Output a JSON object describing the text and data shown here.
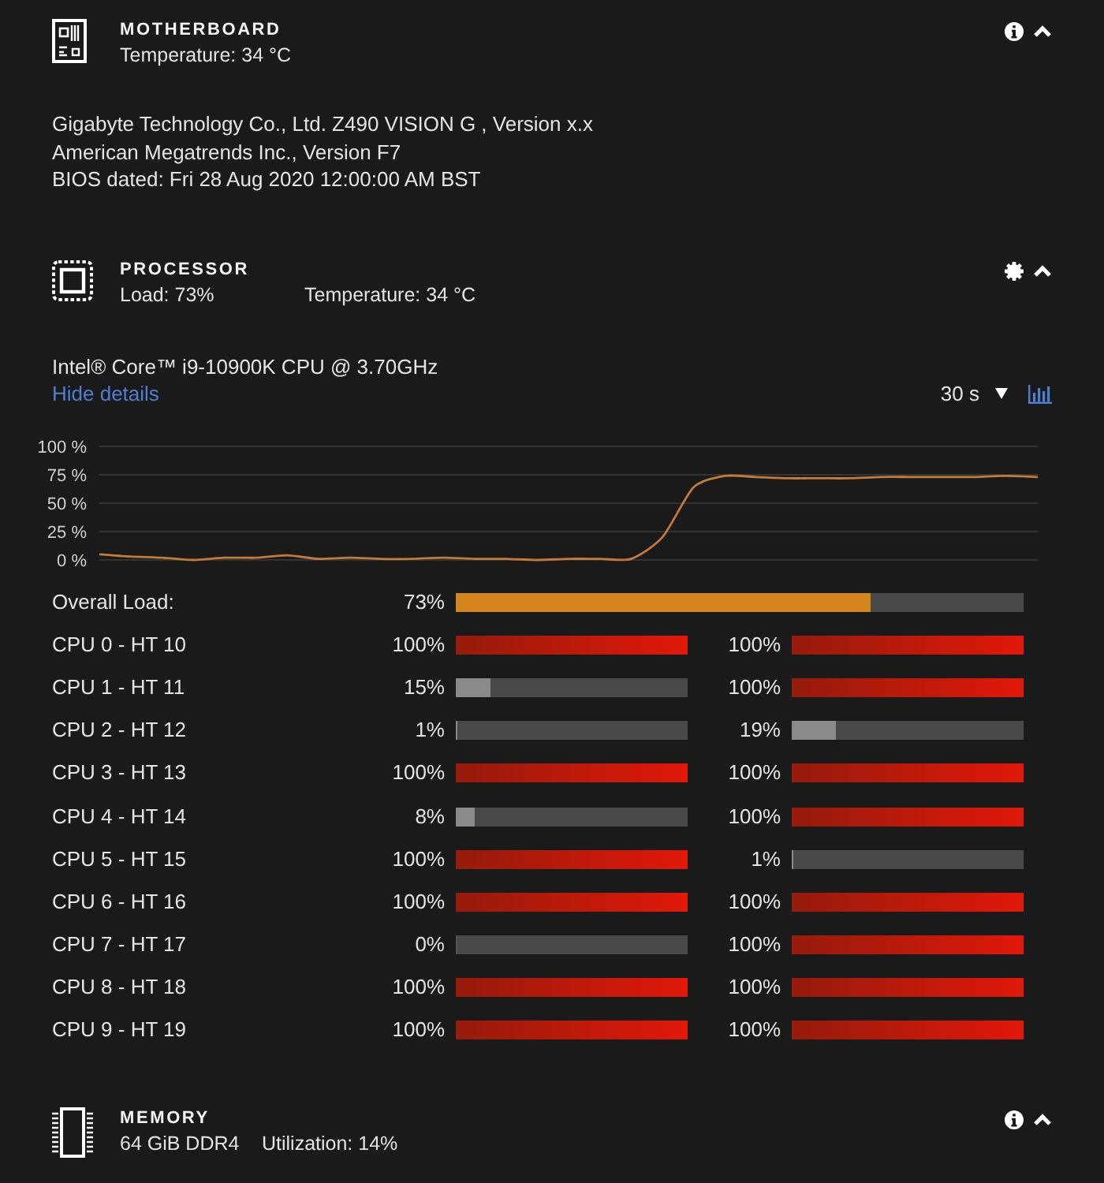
{
  "sections": [
    {
      "kind": "motherboard",
      "title": "MOTHERBOARD",
      "expanded": true,
      "stats": [
        "Temperature: 34 °C"
      ],
      "details": [
        "Gigabyte Technology Co., Ltd. Z490 VISION G , Version x.x",
        "American Megatrends Inc., Version F7",
        "BIOS dated: Fri 28 Aug 2020 12:00:00 AM BST"
      ]
    },
    {
      "kind": "processor",
      "title": "PROCESSOR",
      "expanded": true,
      "stats": [
        "Load: 73%",
        "Temperature: 34 °C"
      ],
      "details": [
        "Intel® Core™ i9-10900K CPU @ 3.70GHz"
      ],
      "toggle_link": "Hide details",
      "interval": "30 s",
      "chart_data": {
        "type": "line",
        "grid": true,
        "ylim": [
          0,
          100
        ],
        "yticks": [
          {
            "value": 0,
            "label": "0 %"
          },
          {
            "value": 25,
            "label": "25 %"
          },
          {
            "value": 50,
            "label": "50 %"
          },
          {
            "value": 75,
            "label": "75 %"
          },
          {
            "value": 100,
            "label": "100 %"
          }
        ],
        "values": [
          5,
          3,
          2,
          0,
          2,
          2,
          4,
          1,
          2,
          1,
          1,
          2,
          1,
          1,
          0,
          1,
          1,
          1,
          20,
          64,
          74,
          73,
          72,
          72,
          72,
          73,
          73,
          73,
          73,
          74,
          73
        ]
      },
      "overall": {
        "label": "Overall Load:",
        "reading": "73%",
        "level": 0.73
      },
      "cores": [
        {
          "label": "CPU 0 - HT 10",
          "threads": [
            {
              "reading": "100%",
              "level": 1
            },
            {
              "reading": "100%",
              "level": 1
            }
          ]
        },
        {
          "label": "CPU 1 - HT 11",
          "threads": [
            {
              "reading": "15%",
              "level": 0.15
            },
            {
              "reading": "100%",
              "level": 1
            }
          ]
        },
        {
          "label": "CPU 2 - HT 12",
          "threads": [
            {
              "reading": "1%",
              "level": 0.01
            },
            {
              "reading": "19%",
              "level": 0.19
            }
          ]
        },
        {
          "label": "CPU 3 - HT 13",
          "threads": [
            {
              "reading": "100%",
              "level": 1
            },
            {
              "reading": "100%",
              "level": 1
            }
          ]
        },
        {
          "label": "CPU 4 - HT 14",
          "threads": [
            {
              "reading": "8%",
              "level": 0.08
            },
            {
              "reading": "100%",
              "level": 1
            }
          ]
        },
        {
          "label": "CPU 5 - HT 15",
          "threads": [
            {
              "reading": "100%",
              "level": 1
            },
            {
              "reading": "1%",
              "level": 0.01
            }
          ]
        },
        {
          "label": "CPU 6 - HT 16",
          "threads": [
            {
              "reading": "100%",
              "level": 1
            },
            {
              "reading": "100%",
              "level": 1
            }
          ]
        },
        {
          "label": "CPU 7 - HT 17",
          "threads": [
            {
              "reading": "0%",
              "level": 0
            },
            {
              "reading": "100%",
              "level": 1
            }
          ]
        },
        {
          "label": "CPU 8 - HT 18",
          "threads": [
            {
              "reading": "100%",
              "level": 1
            },
            {
              "reading": "100%",
              "level": 1
            }
          ]
        },
        {
          "label": "CPU 9 - HT 19",
          "threads": [
            {
              "reading": "100%",
              "level": 1
            },
            {
              "reading": "100%",
              "level": 1
            }
          ]
        }
      ]
    },
    {
      "kind": "memory",
      "title": "MEMORY",
      "expanded": true,
      "stats": [
        "64 GiB DDR4",
        "Utilization: 14%"
      ]
    }
  ]
}
